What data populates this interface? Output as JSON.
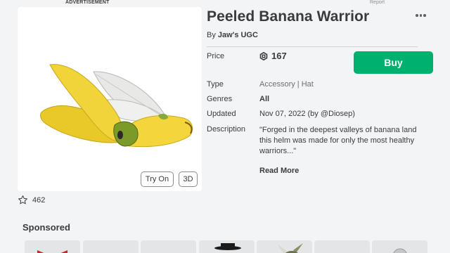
{
  "ad": {
    "label": "ADVERTISEMENT",
    "report": "Report"
  },
  "item": {
    "title": "Peeled Banana Warrior",
    "by_prefix": "By",
    "creator": "Jaw's UGC",
    "price_label": "Price",
    "price": "167",
    "buy_label": "Buy",
    "type_label": "Type",
    "type_value": "Accessory | Hat",
    "genres_label": "Genres",
    "genres_value": "All",
    "updated_label": "Updated",
    "updated_value": "Nov 07, 2022 (by @Diosep)",
    "description_label": "Description",
    "description_lines": [
      "\"Forged in the deepest valleys of banana land",
      "this helm was made for only the most healthy",
      "warriors...\""
    ],
    "read_more": "Read More"
  },
  "thumbnail": {
    "try_on": "Try On",
    "btn_3d": "3D"
  },
  "favorites": {
    "count": "462"
  },
  "sponsored": {
    "title": "Sponsored",
    "cards": [
      "red-bow",
      "blank",
      "blank",
      "black-top-hat",
      "horned-helmet",
      "blank",
      "silver-orb"
    ]
  },
  "colors": {
    "buy": "#00b06f",
    "banana": "#f2d43a",
    "text": "#393b3d"
  },
  "icons": {
    "robux": "robux-icon",
    "star": "star-outline-icon",
    "more": "more-dots-icon"
  }
}
